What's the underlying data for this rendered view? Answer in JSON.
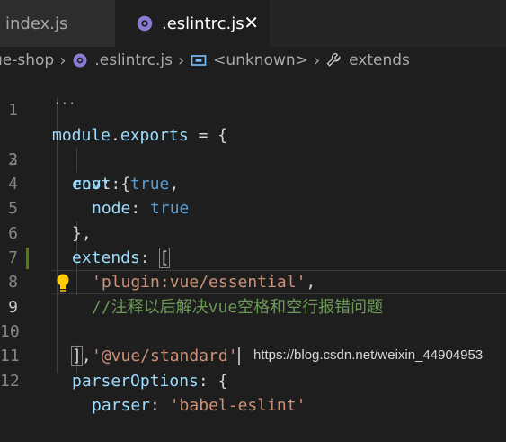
{
  "tabs": [
    {
      "label": "index.js",
      "active": false
    },
    {
      "label": ".eslintrc.js",
      "active": true,
      "close": "✕"
    }
  ],
  "breadcrumb": {
    "project": "ue-shop",
    "file": ".eslintrc.js",
    "symbol": "<unknown>",
    "property": "extends"
  },
  "editor": {
    "lines": [
      {
        "n": "1"
      },
      {
        "n": "2"
      },
      {
        "n": "3"
      },
      {
        "n": "4"
      },
      {
        "n": "5"
      },
      {
        "n": "6"
      },
      {
        "n": "7"
      },
      {
        "n": "8"
      },
      {
        "n": "9"
      },
      {
        "n": "10"
      },
      {
        "n": "11"
      },
      {
        "n": "12"
      }
    ],
    "tokens": {
      "module": "module",
      "dot": ".",
      "exports": "exports",
      "eq_brace": " = {",
      "root_key": "root",
      "root_colon": ": ",
      "root_val": "true",
      "root_comma": ",",
      "env_key": "env",
      "env_rest": ": {",
      "node_key": "node",
      "node_colon": ": ",
      "node_val": "true",
      "close_brace_comma": "},",
      "extends_key": "extends",
      "extends_colon": ": ",
      "open_bracket": "[",
      "str_essential": "'plugin:vue/essential'",
      "comma": ",",
      "comment": "//注释以后解决vue空格和空行报错问题",
      "str_standard": "'@vue/standard'",
      "close_bracket": "]",
      "close_bracket_comma": ",",
      "parser_options_key": "parserOptions",
      "parser_options_rest": ": {",
      "parser_key": "parser",
      "parser_colon": ": ",
      "parser_val": "'babel-eslint'"
    }
  },
  "watermark": "https://blog.csdn.net/weixin_44904953",
  "colors": {
    "background": "#1e1e1e",
    "keyword": "#569cd6",
    "variable": "#9cdcfe",
    "string": "#ce9178",
    "comment": "#6a9955",
    "lightbulb": "#ffcc00"
  }
}
